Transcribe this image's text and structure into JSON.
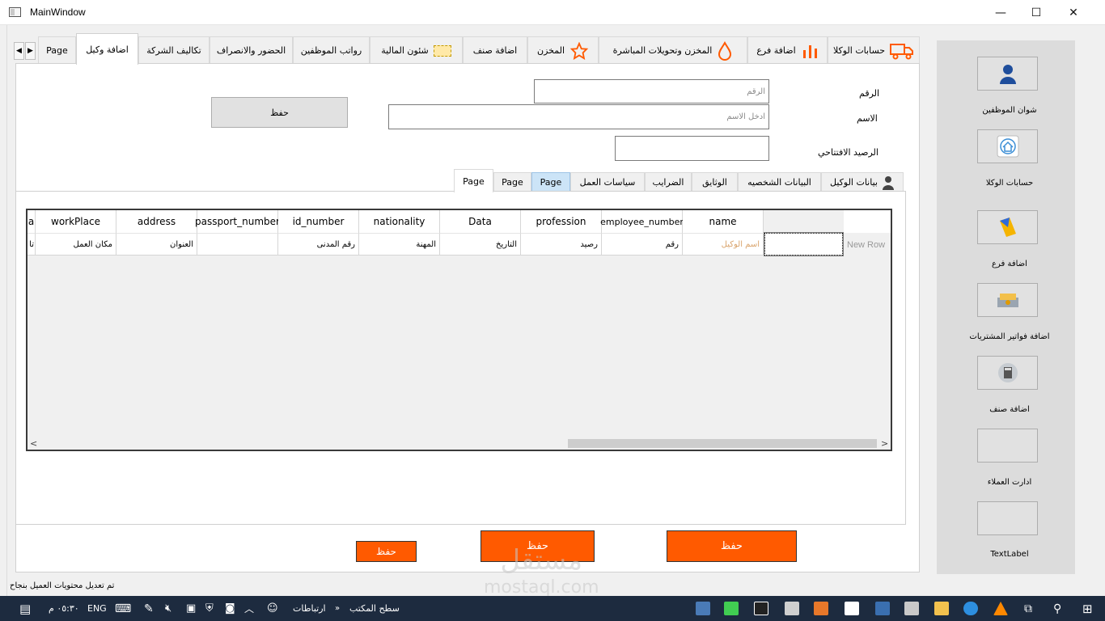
{
  "window": {
    "title": "MainWindow",
    "minimize": "—",
    "maximize": "☐",
    "close": "✕"
  },
  "tabs": [
    {
      "label": "Page",
      "active": false
    },
    {
      "label": "اضافة وكيل",
      "active": true
    },
    {
      "label": "تكاليف الشركة",
      "active": false
    },
    {
      "label": "الحضور والانصراف",
      "active": false
    },
    {
      "label": "رواتب الموظفين",
      "active": false
    },
    {
      "label": "شئون المالية",
      "active": false
    },
    {
      "label": "اضافة صنف",
      "active": false
    },
    {
      "label": "المخزن",
      "active": false
    },
    {
      "label": "المخزن وتحويلات المباشرة",
      "active": false
    },
    {
      "label": "اضافة فرع",
      "active": false
    },
    {
      "label": "حسابات الوكلا",
      "active": false
    }
  ],
  "form": {
    "number_label": "الرقم",
    "number_placeholder": "الرقم",
    "name_label": "الاسم",
    "name_placeholder": "ادخل الاسم",
    "opening_balance_label": "الرصيد الافتتاحي",
    "opening_balance_value": "",
    "save_button": "حفظ"
  },
  "inner_tabs": [
    {
      "label": "Page",
      "active": true
    },
    {
      "label": "Page",
      "active": false
    },
    {
      "label": "Page",
      "active": false,
      "highlighted": true
    },
    {
      "label": "سياسات العمل",
      "active": false
    },
    {
      "label": "الضرايب",
      "active": false
    },
    {
      "label": "الوثايق",
      "active": false
    },
    {
      "label": "البيانات الشخصيه",
      "active": false
    },
    {
      "label": "بيانات الوكيل",
      "active": false
    }
  ],
  "table": {
    "columns": [
      "a",
      "workPlace",
      "address",
      "passport_number",
      "id_number",
      "nationality",
      "Data",
      "profession",
      "employee_number",
      "name"
    ],
    "row": [
      "تا",
      "مكان العمل",
      "العنوان",
      "",
      "رقم المدنى",
      "المهنة",
      "التاريخ",
      "رصيد",
      "رقم",
      "اسم الوكيل"
    ],
    "new_row_label": "New Row",
    "scroll_left": "<",
    "scroll_right": ">"
  },
  "bottom_buttons": {
    "save_small": "حفظ",
    "save_middle": "حفظ",
    "save_right": "حفظ"
  },
  "sidebar": {
    "items": [
      {
        "label": "شوان الموظفين",
        "icon": "employee-icon"
      },
      {
        "label": "حسابات الوكلا",
        "icon": "home-icon"
      },
      {
        "label": "اضافة فرع",
        "icon": "branch-icon"
      },
      {
        "label": "اضافة فواتير المشتريات",
        "icon": "invoice-icon"
      },
      {
        "label": "اضافة صنف",
        "icon": "calculator-icon"
      },
      {
        "label": "ادارت العملاء",
        "icon": ""
      },
      {
        "label": "TextLabel",
        "icon": ""
      }
    ]
  },
  "status": {
    "message": "تم تعديل محتويات العميل بنجاح"
  },
  "taskbar": {
    "time": "٠٥:٣٠ م",
    "language": "ENG",
    "connections": "ارتباطات",
    "desktop": "سطح المكتب"
  },
  "watermark": {
    "line1": "مستقل",
    "line2": "mostaql.com"
  },
  "colors": {
    "accent_orange": "#ff5a00",
    "selected_tab_blue": "#cce4f7",
    "taskbar": "#1d2b3f"
  }
}
